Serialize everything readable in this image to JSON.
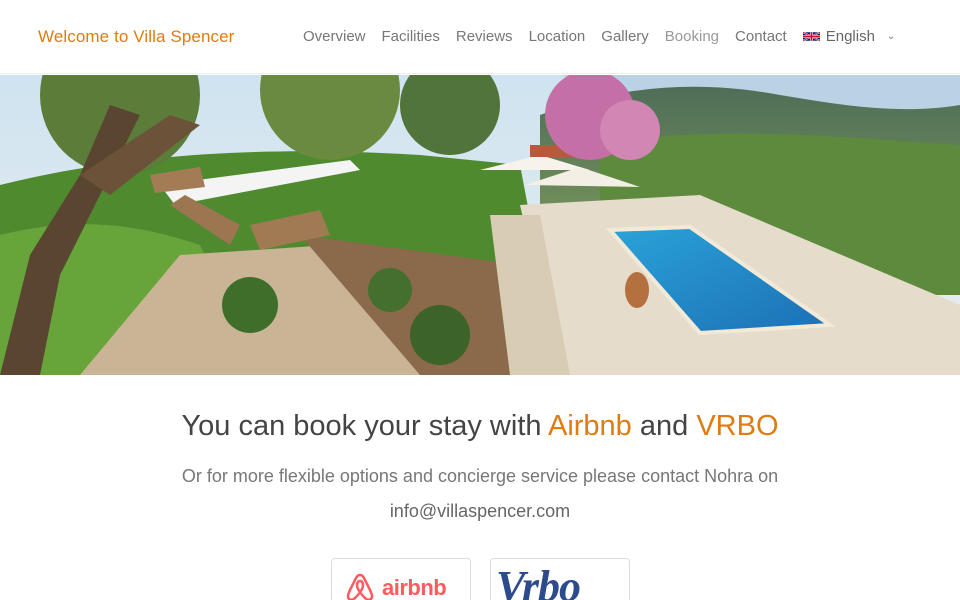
{
  "header": {
    "brand": "Welcome to Villa Spencer",
    "nav": [
      "Overview",
      "Facilities",
      "Reviews",
      "Location",
      "Gallery",
      "Booking",
      "Contact"
    ],
    "language": "English"
  },
  "hero": {
    "icons": [
      "flag-uk-icon",
      "chevron-down-icon"
    ]
  },
  "booking": {
    "title_prefix": "You can book your stay with",
    "airbnb": "Airbnb",
    "and": "and",
    "vrbo": "VRBO",
    "subtitle": "Or for more flexible options and concierge service please contact Nohra on",
    "email": "info@villaspencer.com",
    "badge_airbnb": "airbnb",
    "badge_vrbo": "Vrbo"
  },
  "colors": {
    "accent": "#e07b10",
    "airbnb": "#ff5a5f",
    "vrbo": "#2c4a8c"
  }
}
